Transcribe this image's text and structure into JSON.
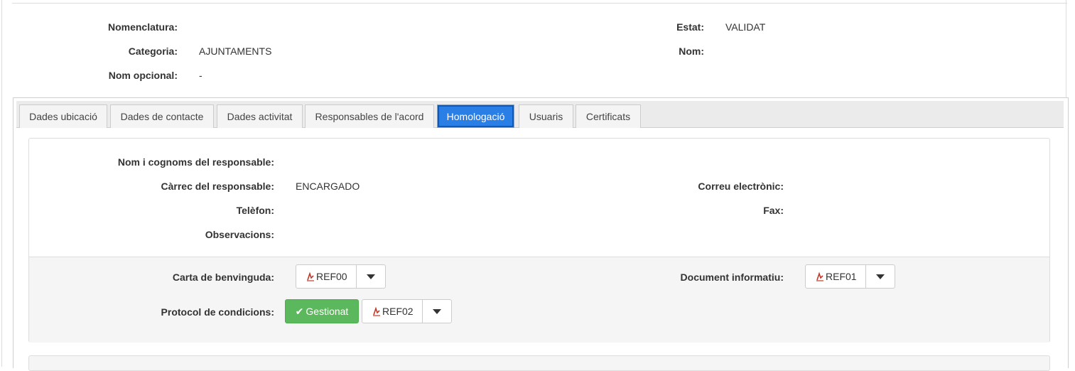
{
  "header": {
    "nomenclatura_label": "Nomenclatura:",
    "nomenclatura_value": "",
    "categoria_label": "Categoria:",
    "categoria_value": "AJUNTAMENTS",
    "nom_opcional_label": "Nom opcional:",
    "nom_opcional_value": "-",
    "estat_label": "Estat:",
    "estat_value": "VALIDAT",
    "nom_label": "Nom:",
    "nom_value": ""
  },
  "tabs": [
    {
      "label": "Dades ubicació"
    },
    {
      "label": "Dades de contacte"
    },
    {
      "label": "Dades activitat"
    },
    {
      "label": "Responsables de l'acord"
    },
    {
      "label": "Homologació",
      "active": true
    },
    {
      "label": "Usuaris"
    },
    {
      "label": "Certificats"
    }
  ],
  "homologacio": {
    "responsable_label": "Nom i cognoms del responsable:",
    "responsable_value": "",
    "carrec_label": "Càrrec del responsable:",
    "carrec_value": "ENCARGADO",
    "correu_label": "Correu electrònic:",
    "correu_value": "",
    "telefon_label": "Telèfon:",
    "telefon_value": "",
    "fax_label": "Fax:",
    "fax_value": "",
    "observacions_label": "Observacions:",
    "observacions_value": ""
  },
  "documents": {
    "carta_label": "Carta de benvinguda:",
    "carta_ref": "REF00",
    "document_label": "Document informatiu:",
    "document_ref": "REF01",
    "protocol_label": "Protocol de condicions:",
    "protocol_status": "Gestionat",
    "protocol_ref": "REF02"
  },
  "colors": {
    "active_tab": "#2a7fe6",
    "success": "#5cb85c",
    "pdf_icon": "#c0392b"
  }
}
